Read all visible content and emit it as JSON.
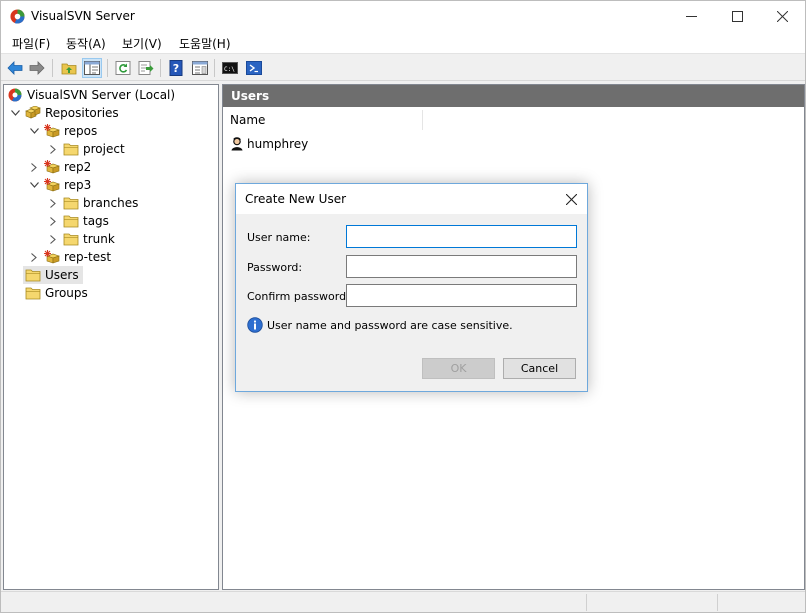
{
  "window": {
    "title": "VisualSVN Server"
  },
  "menu": [
    "파일(F)",
    "동작(A)",
    "보기(V)",
    "도움말(H)"
  ],
  "tree": {
    "root": "VisualSVN Server (Local)",
    "repositories": "Repositories",
    "repos": "repos",
    "project": "project",
    "rep2": "rep2",
    "rep3": "rep3",
    "branches": "branches",
    "tags": "tags",
    "trunk": "trunk",
    "rep_test": "rep-test",
    "users": "Users",
    "groups": "Groups"
  },
  "panel": {
    "title": "Users",
    "column_name": "Name",
    "users": [
      "humphrey"
    ]
  },
  "dialog": {
    "title": "Create New User",
    "user_name_label": "User name:",
    "password_label": "Password:",
    "confirm_label": "Confirm password:",
    "user_name_value": "",
    "password_value": "",
    "confirm_value": "",
    "info": "User name and password are case sensitive.",
    "ok": "OK",
    "cancel": "Cancel"
  },
  "colors": {
    "accent": "#0078d7",
    "header_bg": "#6e6e6e",
    "folder": "#f5d76e"
  }
}
